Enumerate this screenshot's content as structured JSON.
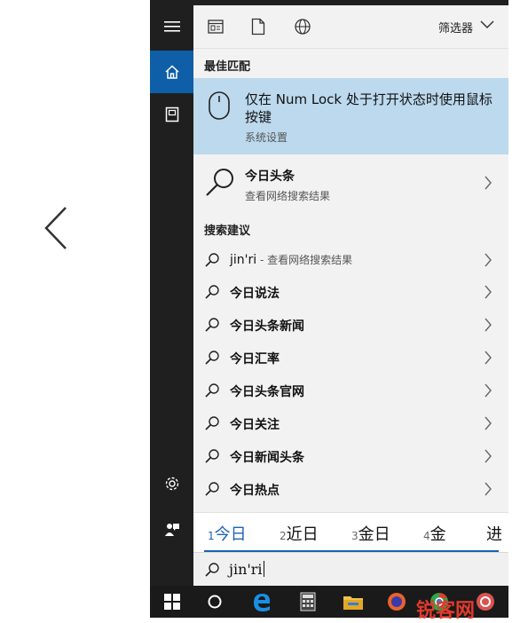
{
  "rail": {
    "items": [
      {
        "name": "hamburger-menu-icon"
      },
      {
        "name": "home-icon",
        "active": true
      },
      {
        "name": "notebook-icon"
      },
      {
        "name": "settings-gear-icon"
      },
      {
        "name": "feedback-icon"
      }
    ]
  },
  "filter_bar": {
    "icons": [
      "apps-icon",
      "documents-icon",
      "web-globe-icon"
    ],
    "filter_label": "筛选器"
  },
  "best_match": {
    "section_title": "最佳匹配",
    "title": "仅在 Num Lock 处于打开状态时使用鼠标按键",
    "subtitle": "系统设置",
    "icon": "mouse-icon"
  },
  "web_result": {
    "title": "今日头条",
    "subtitle": "查看网络搜索结果",
    "icon": "search-icon"
  },
  "suggestions": {
    "section_title": "搜索建议",
    "first": {
      "text": "jin'ri",
      "hint": " - 查看网络搜索结果"
    },
    "items": [
      "今日说法",
      "今日头条新闻",
      "今日汇率",
      "今日头条官网",
      "今日关注",
      "今日新闻头条",
      "今日热点"
    ]
  },
  "ime": {
    "candidates": [
      {
        "num": "1",
        "text": "今日"
      },
      {
        "num": "2",
        "text": "近日"
      },
      {
        "num": "3",
        "text": "金日"
      },
      {
        "num": "4",
        "text": "金"
      },
      {
        "num": "",
        "text": "进"
      }
    ],
    "accent_color": "#1a62b8"
  },
  "search": {
    "value": "jin'ri"
  },
  "taskbar": {
    "items": [
      "windows-start-icon",
      "cortana-circle-icon",
      "edge-browser-icon",
      "calculator-icon",
      "file-explorer-icon",
      "firefox-icon",
      "chrome-icon",
      "app-icon"
    ],
    "watermark": "锐客网"
  },
  "colors": {
    "active_rail": "#0e5ea8",
    "best_match_bg": "#bcd9ee",
    "panel_bg": "#f2f2f2"
  }
}
